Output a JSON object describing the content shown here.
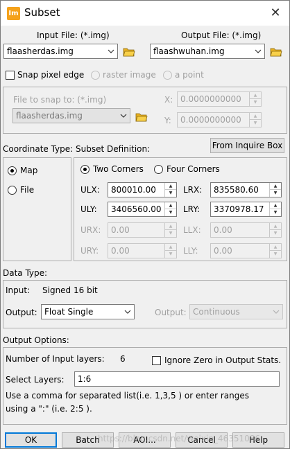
{
  "window": {
    "title": "Subset",
    "app_icon": "Im",
    "close_label": "✕"
  },
  "input_file": {
    "label": "Input File: (*.img)",
    "value": "flaasherdas.img"
  },
  "output_file": {
    "label": "Output File: (*.img)",
    "value": "flaashwuhan.img"
  },
  "snap": {
    "checkbox_label": "Snap pixel edge",
    "raster_label": "raster image",
    "point_label": "a point",
    "file_label": "File to snap to: (*.img)",
    "file_value": "flaasherdas.img",
    "x_label": "X:",
    "x_value": "0.0000000000",
    "y_label": "Y:",
    "y_value": "0.0000000000"
  },
  "coordinate": {
    "type_label": "Coordinate Type:",
    "map_label": "Map",
    "file_label": "File",
    "selected": "Map"
  },
  "subset": {
    "definition_label": "Subset Definition:",
    "inquire_button": "From Inquire Box",
    "two_corners_label": "Two Corners",
    "four_corners_label": "Four Corners",
    "selected": "Two Corners",
    "fields": {
      "ulx_label": "ULX:",
      "ulx": "800010.00",
      "lrx_label": "LRX:",
      "lrx": "835580.60",
      "uly_label": "ULY:",
      "uly": "3406560.00",
      "lry_label": "LRY:",
      "lry": "3370978.17",
      "urx_label": "URX:",
      "urx": "0.00",
      "llx_label": "LLX:",
      "llx": "0.00",
      "ury_label": "URY:",
      "ury": "0.00",
      "lly_label": "LLY:",
      "lly": "0.00"
    }
  },
  "data_type": {
    "section_label": "Data Type:",
    "input_label": "Input:",
    "input_value": "Signed 16 bit",
    "output_label": "Output:",
    "output_value": "Float Single",
    "output2_label": "Output:",
    "output2_value": "Continuous"
  },
  "output_options": {
    "section_label": "Output Options:",
    "num_layers_label": "Number of Input layers:",
    "num_layers_value": "6",
    "ignore_zero_label": "Ignore Zero in Output Stats.",
    "select_layers_label": "Select Layers:",
    "select_layers_value": "1:6",
    "help_line1": "Use a comma for separated list(i.e. 1,3,5 ) or enter ranges",
    "help_line2": "using a \":\" (i.e. 2:5 )."
  },
  "buttons": {
    "ok": "OK",
    "batch": "Batch",
    "aoi": "AOI...",
    "cancel": "Cancel",
    "help": "Help"
  },
  "watermark": "https://blog.csdn.net/weixin_46351086"
}
